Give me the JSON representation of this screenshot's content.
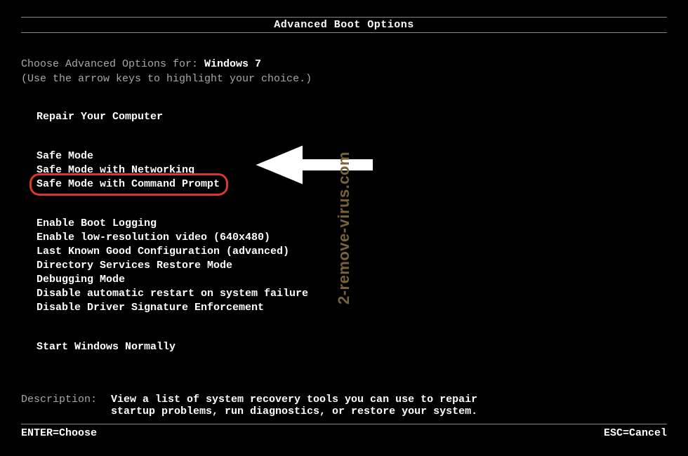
{
  "title": "Advanced Boot Options",
  "choose_prefix": "Choose Advanced Options for: ",
  "os_name": "Windows 7",
  "hint": "(Use the arrow keys to highlight your choice.)",
  "menu": {
    "group1": [
      "Repair Your Computer"
    ],
    "group2": [
      "Safe Mode",
      "Safe Mode with Networking",
      "Safe Mode with Command Prompt"
    ],
    "group3": [
      "Enable Boot Logging",
      "Enable low-resolution video (640x480)",
      "Last Known Good Configuration (advanced)",
      "Directory Services Restore Mode",
      "Debugging Mode",
      "Disable automatic restart on system failure",
      "Disable Driver Signature Enforcement"
    ],
    "group4": [
      "Start Windows Normally"
    ],
    "highlighted_index_group2": 2
  },
  "description": {
    "label": "Description:",
    "line1": "View a list of system recovery tools you can use to repair",
    "line2": "startup problems, run diagnostics, or restore your system."
  },
  "footer": {
    "left": "ENTER=Choose",
    "right": "ESC=Cancel"
  },
  "watermark": "2-remove-virus.com",
  "annotation": {
    "ring_color": "#d63a2a",
    "arrow_color": "#ffffff"
  }
}
